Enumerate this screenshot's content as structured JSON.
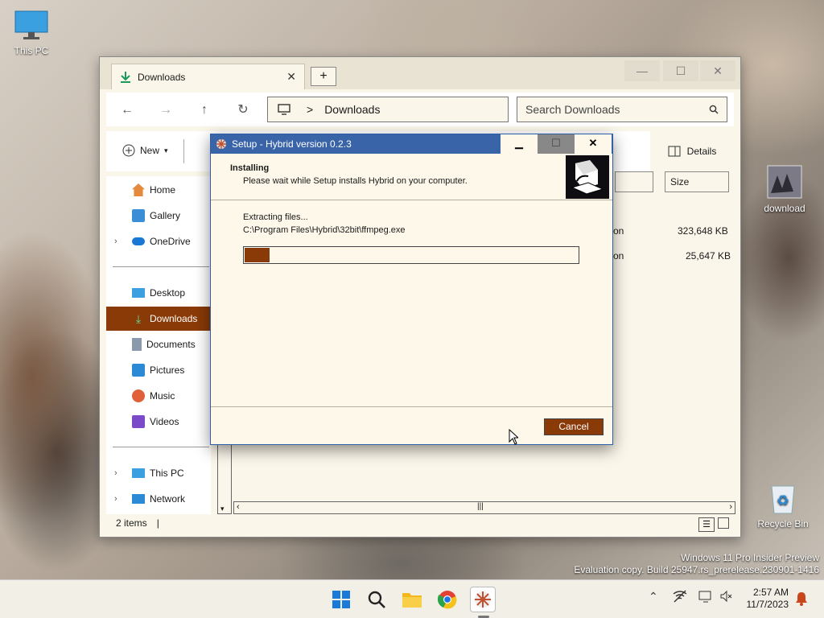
{
  "desktop": {
    "icons": [
      {
        "label": "This PC",
        "icon": "monitor-icon"
      },
      {
        "label": "download",
        "icon": "image-file-icon"
      },
      {
        "label": "Recycle Bin",
        "icon": "recycle-bin-icon"
      }
    ],
    "watermark_line1": "Windows 11 Pro Insider Preview",
    "watermark_line2": "Evaluation copy. Build 25947.rs_prerelease.230901-1416"
  },
  "explorer": {
    "tab_title": "Downloads",
    "new_tab": "+",
    "address": "Downloads",
    "address_sep": ">",
    "search_placeholder": "Search Downloads",
    "new_label": "New",
    "details_label": "Details",
    "nav": {
      "home": "Home",
      "gallery": "Gallery",
      "onedrive": "OneDrive",
      "desktop": "Desktop",
      "downloads": "Downloads",
      "documents": "Documents",
      "pictures": "Pictures",
      "music": "Music",
      "videos": "Videos",
      "thispc": "This PC",
      "network": "Network"
    },
    "size_header": "Size",
    "rows": [
      {
        "type_fragment": "on",
        "size": "323,648 KB"
      },
      {
        "type_fragment": "on",
        "size": "25,647 KB"
      }
    ],
    "status": "2 items"
  },
  "setup": {
    "title": "Setup - Hybrid version 0.2.3",
    "heading": "Installing",
    "subheading": "Please wait while Setup installs Hybrid on your computer.",
    "status": "Extracting files...",
    "path": "C:\\Program Files\\Hybrid\\32bit\\ffmpeg.exe",
    "progress": 0.08,
    "cancel_label": "Cancel"
  },
  "taskbar": {
    "time": "2:57 AM",
    "date": "11/7/2023"
  },
  "colors": {
    "accent": "#8a3a06",
    "title_bar": "#3a64a8"
  }
}
